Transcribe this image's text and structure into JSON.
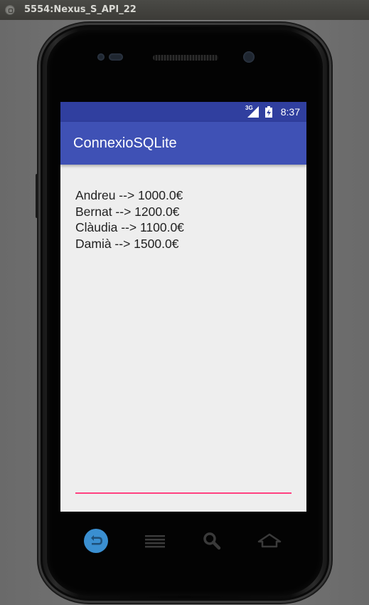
{
  "window": {
    "title": "5554:Nexus_S_API_22",
    "close_icon": "window-close-icon"
  },
  "status_bar": {
    "network": "3G",
    "time": "8:37",
    "color": "#303f9f"
  },
  "app_bar": {
    "title": "ConnexioSQLite",
    "color": "#3f51b5"
  },
  "content": {
    "lines": [
      "Andreu --> 1000.0€",
      "Bernat --> 1200.0€",
      "Clàudia --> 1100.0€",
      "Damià --> 1500.0€"
    ]
  },
  "input": {
    "value": "",
    "underline_color": "#ff4081"
  },
  "nav": {
    "buttons": [
      "back-icon",
      "menu-icon",
      "search-icon",
      "home-icon"
    ],
    "back_color": "#3a8fd1"
  }
}
